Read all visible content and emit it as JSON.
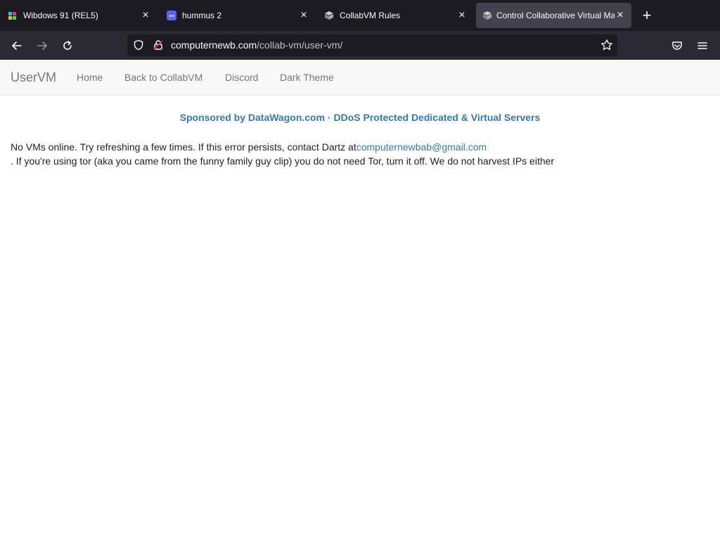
{
  "browser": {
    "tabs": [
      {
        "title": "Wibdows 91 (REL5)",
        "active": false
      },
      {
        "title": "hummus 2",
        "active": false
      },
      {
        "title": "CollabVM Rules",
        "active": false
      },
      {
        "title": "Control Collaborative Virtual Ma",
        "active": true
      }
    ],
    "close_glyph": "×",
    "new_tab_glyph": "+",
    "url_domain": "computernewb.com",
    "url_path": "/collab-vm/user-vm/"
  },
  "site": {
    "brand": "UserVM",
    "nav": [
      "Home",
      "Back to CollabVM",
      "Discord",
      "Dark Theme"
    ],
    "sponsor": "Sponsored by DataWagon.com · DDoS Protected Dedicated & Virtual Servers",
    "message_prefix": "No VMs online. Try refreshing a few times. If this error persists, contact Dartz at",
    "email": "computernewbab@gmail.com",
    "message_suffix": ". If you're using tor (aka you came from the funny family guy clip) you do not need Tor, turn it off. We do not harvest IPs either"
  },
  "colors": {
    "link": "#337ab7",
    "tabbar": "#1c1b22",
    "toolbar": "#2b2a33"
  }
}
